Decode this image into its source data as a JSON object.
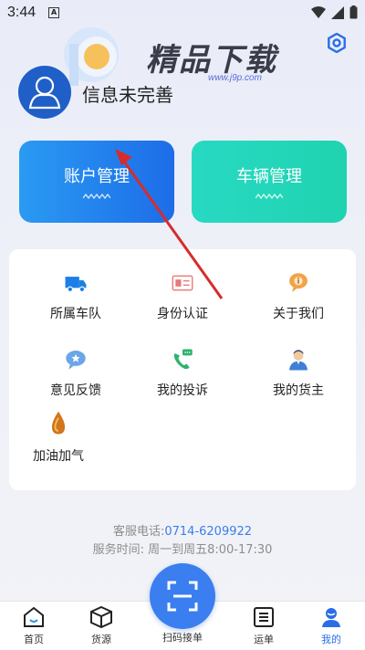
{
  "status_bar": {
    "time": "3:44",
    "notification_icon": "A"
  },
  "watermark": {
    "brand_text": "精品下载",
    "url": "www.j9p.com"
  },
  "profile": {
    "name": "信息未完善"
  },
  "cards": {
    "account": "账户管理",
    "vehicle": "车辆管理"
  },
  "menu": {
    "items": [
      {
        "label": "所属车队",
        "icon": "truck-icon"
      },
      {
        "label": "身份认证",
        "icon": "id-card-icon"
      },
      {
        "label": "关于我们",
        "icon": "info-bubble-icon"
      },
      {
        "label": "意见反馈",
        "icon": "feedback-bubble-icon"
      },
      {
        "label": "我的投诉",
        "icon": "phone-chat-icon"
      },
      {
        "label": "我的货主",
        "icon": "person-icon"
      },
      {
        "label": "加油加气",
        "icon": "fuel-drop-icon"
      }
    ]
  },
  "service": {
    "phone_label": "客服电话:",
    "phone": "0714-6209922",
    "hours": "服务时间: 周一到周五8:00-17:30"
  },
  "nav": {
    "home": "首页",
    "cargo": "货源",
    "scan": "扫码接单",
    "waybill": "运单",
    "mine": "我的"
  },
  "colors": {
    "primary": "#2a6ee6",
    "account_card": "#1d6de8",
    "vehicle_card": "#1fd3b0",
    "scan_button": "#3a7ef0"
  }
}
